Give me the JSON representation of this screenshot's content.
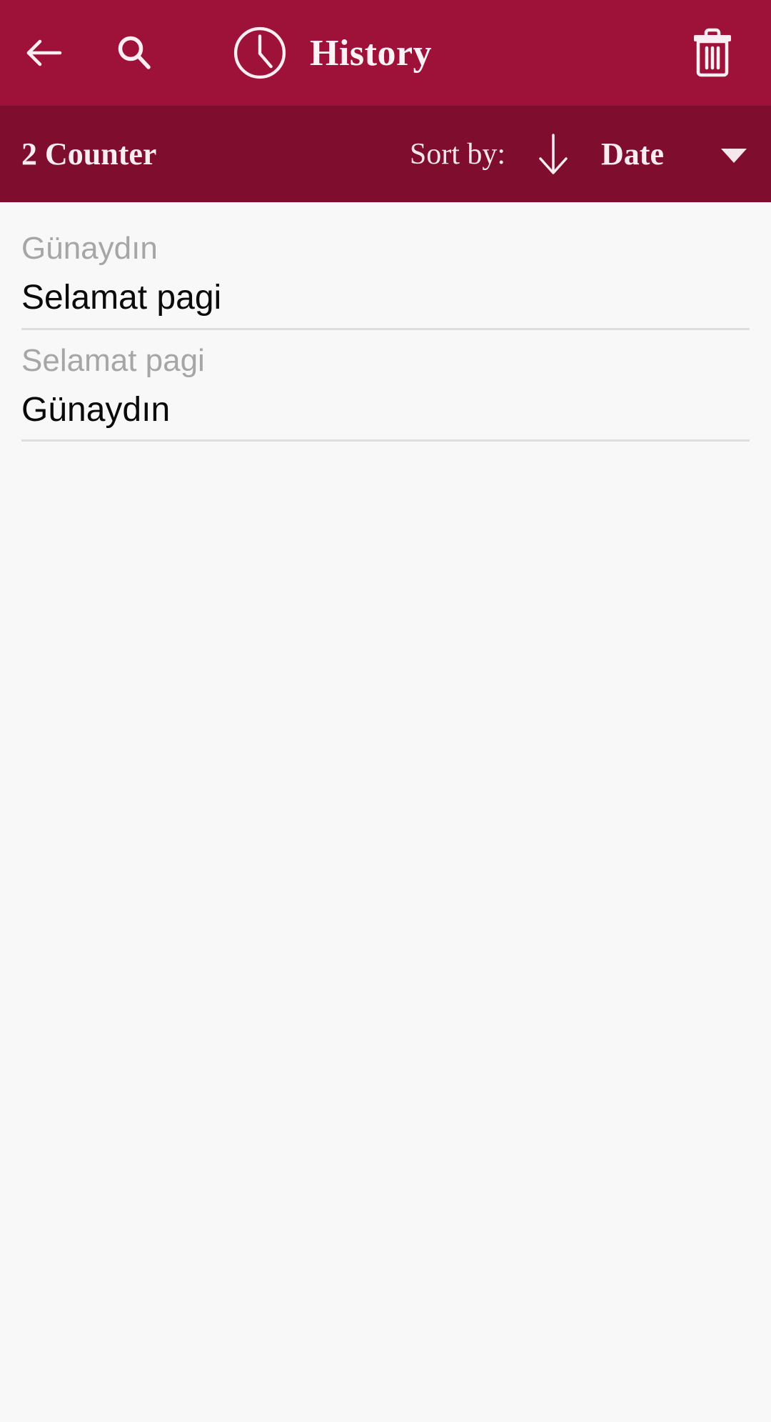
{
  "appbar": {
    "background_color": "#9E1239",
    "back_icon": "back-arrow-icon",
    "search_icon": "search-icon",
    "clock_icon": "clock-icon",
    "title": "History",
    "delete_icon": "trash-icon"
  },
  "sortbar": {
    "background_color": "#7F0E2E",
    "counter_label": "2 Counter",
    "sort_by_label": "Sort by:",
    "sort_direction_icon": "arrow-down-icon",
    "sort_value": "Date",
    "dropdown_icon": "caret-down-icon"
  },
  "list": {
    "background_color": "#F8F8F8",
    "source_text_color": "#A6A6A6",
    "target_text_color": "#0A0A0A",
    "items": [
      {
        "source": "Günaydın",
        "target": "Selamat pagi"
      },
      {
        "source": "Selamat pagi",
        "target": "Günaydın"
      }
    ]
  }
}
